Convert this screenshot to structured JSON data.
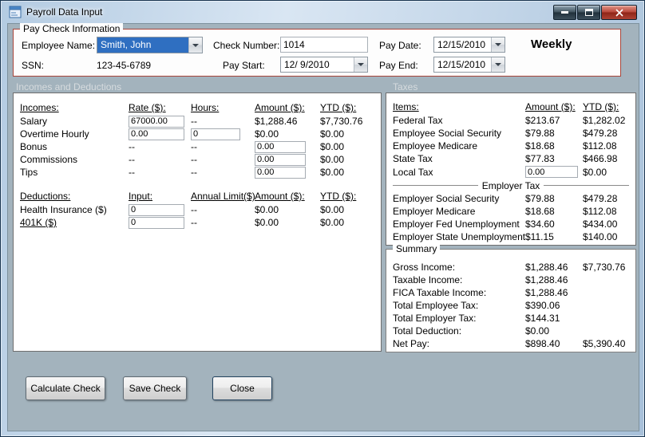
{
  "titlebar": {
    "title": "Payroll Data Input"
  },
  "colors": {
    "selection_blue": "#2f6fc1",
    "group_border_red": "#a8453a",
    "form_background": "#a3b3bd"
  },
  "paycheck": {
    "legend": "Pay Check Information",
    "employee_label": "Employee Name:",
    "employee_value": "Smith, John",
    "ssn_label": "SSN:",
    "ssn_value": "123-45-6789",
    "check_number_label": "Check Number:",
    "check_number_value": "1014",
    "pay_start_label": "Pay Start:",
    "pay_start_value": "12/ 9/2010",
    "pay_date_label": "Pay Date:",
    "pay_date_value": "12/15/2010",
    "pay_end_label": "Pay End:",
    "pay_end_value": "12/15/2010",
    "frequency": "Weekly"
  },
  "sections": {
    "incomes_deductions": "Incomes and Deductions",
    "taxes": "Taxes"
  },
  "incomes": {
    "headers": {
      "name": "Incomes:",
      "rate": "Rate ($):",
      "hours": "Hours:",
      "amount": "Amount ($):",
      "ytd": "YTD ($):"
    },
    "rows": [
      {
        "label": "Salary",
        "rate": "67000.00",
        "hours": "--",
        "amount": "$1,288.46",
        "ytd": "$7,730.76"
      },
      {
        "label": "Overtime Hourly",
        "rate": "0.00",
        "hours": "0",
        "amount": "$0.00",
        "ytd": "$0.00"
      },
      {
        "label": "Bonus",
        "rate": "--",
        "hours": "--",
        "amount": "0.00",
        "ytd": "$0.00"
      },
      {
        "label": "Commissions",
        "rate": "--",
        "hours": "--",
        "amount": "0.00",
        "ytd": "$0.00"
      },
      {
        "label": "Tips",
        "rate": "--",
        "hours": "--",
        "amount": "0.00",
        "ytd": "$0.00"
      }
    ]
  },
  "deductions": {
    "headers": {
      "name": "Deductions:",
      "input": "Input:",
      "limit": "Annual Limit($):",
      "amount": "Amount ($):",
      "ytd": "YTD ($):"
    },
    "rows": [
      {
        "label": "Health Insurance  ($)",
        "input": "0",
        "limit": "--",
        "amount": "$0.00",
        "ytd": "$0.00"
      },
      {
        "label": "401K  ($)",
        "input": "0",
        "limit": "--",
        "amount": "$0.00",
        "ytd": "$0.00"
      }
    ]
  },
  "taxes": {
    "headers": {
      "items": "Items:",
      "amount": "Amount ($):",
      "ytd": "YTD ($):"
    },
    "employee_rows": [
      {
        "label": "Federal Tax",
        "amount": "$213.67",
        "ytd": "$1,282.02"
      },
      {
        "label": "Employee Social Security",
        "amount": "$79.88",
        "ytd": "$479.28"
      },
      {
        "label": "Employee Medicare",
        "amount": "$18.68",
        "ytd": "$112.08"
      },
      {
        "label": "State Tax",
        "amount": "$77.83",
        "ytd": "$466.98"
      },
      {
        "label": "Local Tax",
        "amount": "0.00",
        "ytd": "$0.00"
      }
    ],
    "employer_header": "Employer Tax",
    "employer_rows": [
      {
        "label": "Employer Social Security",
        "amount": "$79.88",
        "ytd": "$479.28"
      },
      {
        "label": "Employer Medicare",
        "amount": "$18.68",
        "ytd": "$112.08"
      },
      {
        "label": "Employer Fed Unemployment",
        "amount": "$34.60",
        "ytd": "$434.00"
      },
      {
        "label": "Employer State Unemployment",
        "amount": "$11.15",
        "ytd": "$140.00"
      }
    ]
  },
  "summary": {
    "legend": "Summary",
    "rows": [
      {
        "label": "Gross Income:",
        "amount": "$1,288.46",
        "ytd": "$7,730.76"
      },
      {
        "label": "Taxable Income:",
        "amount": "$1,288.46",
        "ytd": ""
      },
      {
        "label": "FICA Taxable Income:",
        "amount": "$1,288.46",
        "ytd": ""
      },
      {
        "label": "Total Employee Tax:",
        "amount": "$390.06",
        "ytd": ""
      },
      {
        "label": "Total Employer Tax:",
        "amount": "$144.31",
        "ytd": ""
      },
      {
        "label": "Total Deduction:",
        "amount": "$0.00",
        "ytd": ""
      },
      {
        "label": "Net Pay:",
        "amount": "$898.40",
        "ytd": "$5,390.40"
      }
    ]
  },
  "buttons": {
    "calculate": "Calculate Check",
    "save": "Save Check",
    "close": "Close"
  }
}
